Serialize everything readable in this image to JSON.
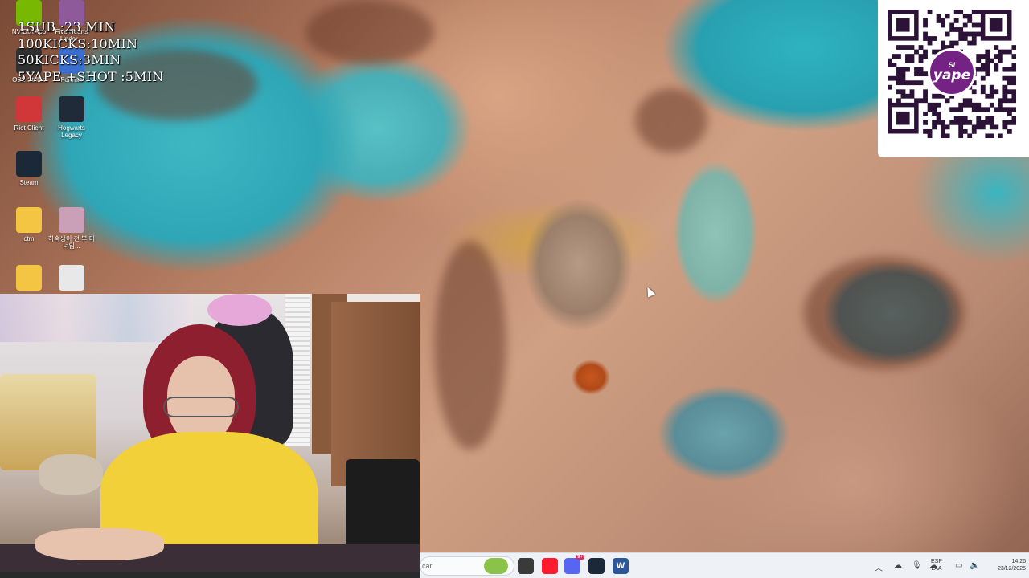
{
  "overlay": {
    "lines": [
      "1SUB :23 MIN",
      "100KICKS:10MIN",
      "50KICKS:3MIN",
      "5YAPE +SHOT :5MIN"
    ]
  },
  "desktop_icons": [
    {
      "label": "NVIDIA App",
      "icon": "nvidia-icon",
      "color": "#76b900"
    },
    {
      "label": "Five Hearts Under...",
      "icon": "game-icon",
      "color": "#8e5a9a"
    },
    {
      "label": "OBS Studio",
      "icon": "obs-icon",
      "color": "#303030"
    },
    {
      "label": "Fortnite",
      "icon": "fortnite-icon",
      "color": "#3a6fd0"
    },
    {
      "label": "Riot Client",
      "icon": "riot-icon",
      "color": "#d13639"
    },
    {
      "label": "Hogwarts Legacy",
      "icon": "hogwarts-icon",
      "color": "#1f2b38"
    },
    {
      "label": "Steam",
      "icon": "steam-icon",
      "color": "#1b2838"
    },
    {
      "label": "ctm",
      "icon": "folder-icon",
      "color": "#f4c542"
    },
    {
      "label": "하숙생이 전 부 미녀임...",
      "icon": "anime-icon",
      "color": "#c9a0b8"
    },
    {
      "label": "portal",
      "icon": "folder-icon",
      "color": "#f4c542"
    },
    {
      "label": "LA HISTORIA",
      "icon": "video-icon",
      "color": "#e8e8e8"
    }
  ],
  "qr": {
    "brand": "yape",
    "currency": "S/",
    "brand_color": "#742384"
  },
  "taskbar": {
    "search_placeholder": "car",
    "apps": [
      {
        "name": "widgets-icon",
        "color": "#8bc34a"
      },
      {
        "name": "chrome-icon",
        "color": "#3a3a3a"
      },
      {
        "name": "opera-icon",
        "color": "#ff1b2d"
      },
      {
        "name": "discord-icon",
        "color": "#5865f2",
        "badge": "9+"
      },
      {
        "name": "steam-icon",
        "color": "#1b2838"
      },
      {
        "name": "word-icon",
        "color": "#2b579a",
        "letter": "W"
      }
    ],
    "lang_top": "ESP",
    "lang_bottom": "LAA",
    "time": "14:26",
    "date": "23/12/2025"
  }
}
